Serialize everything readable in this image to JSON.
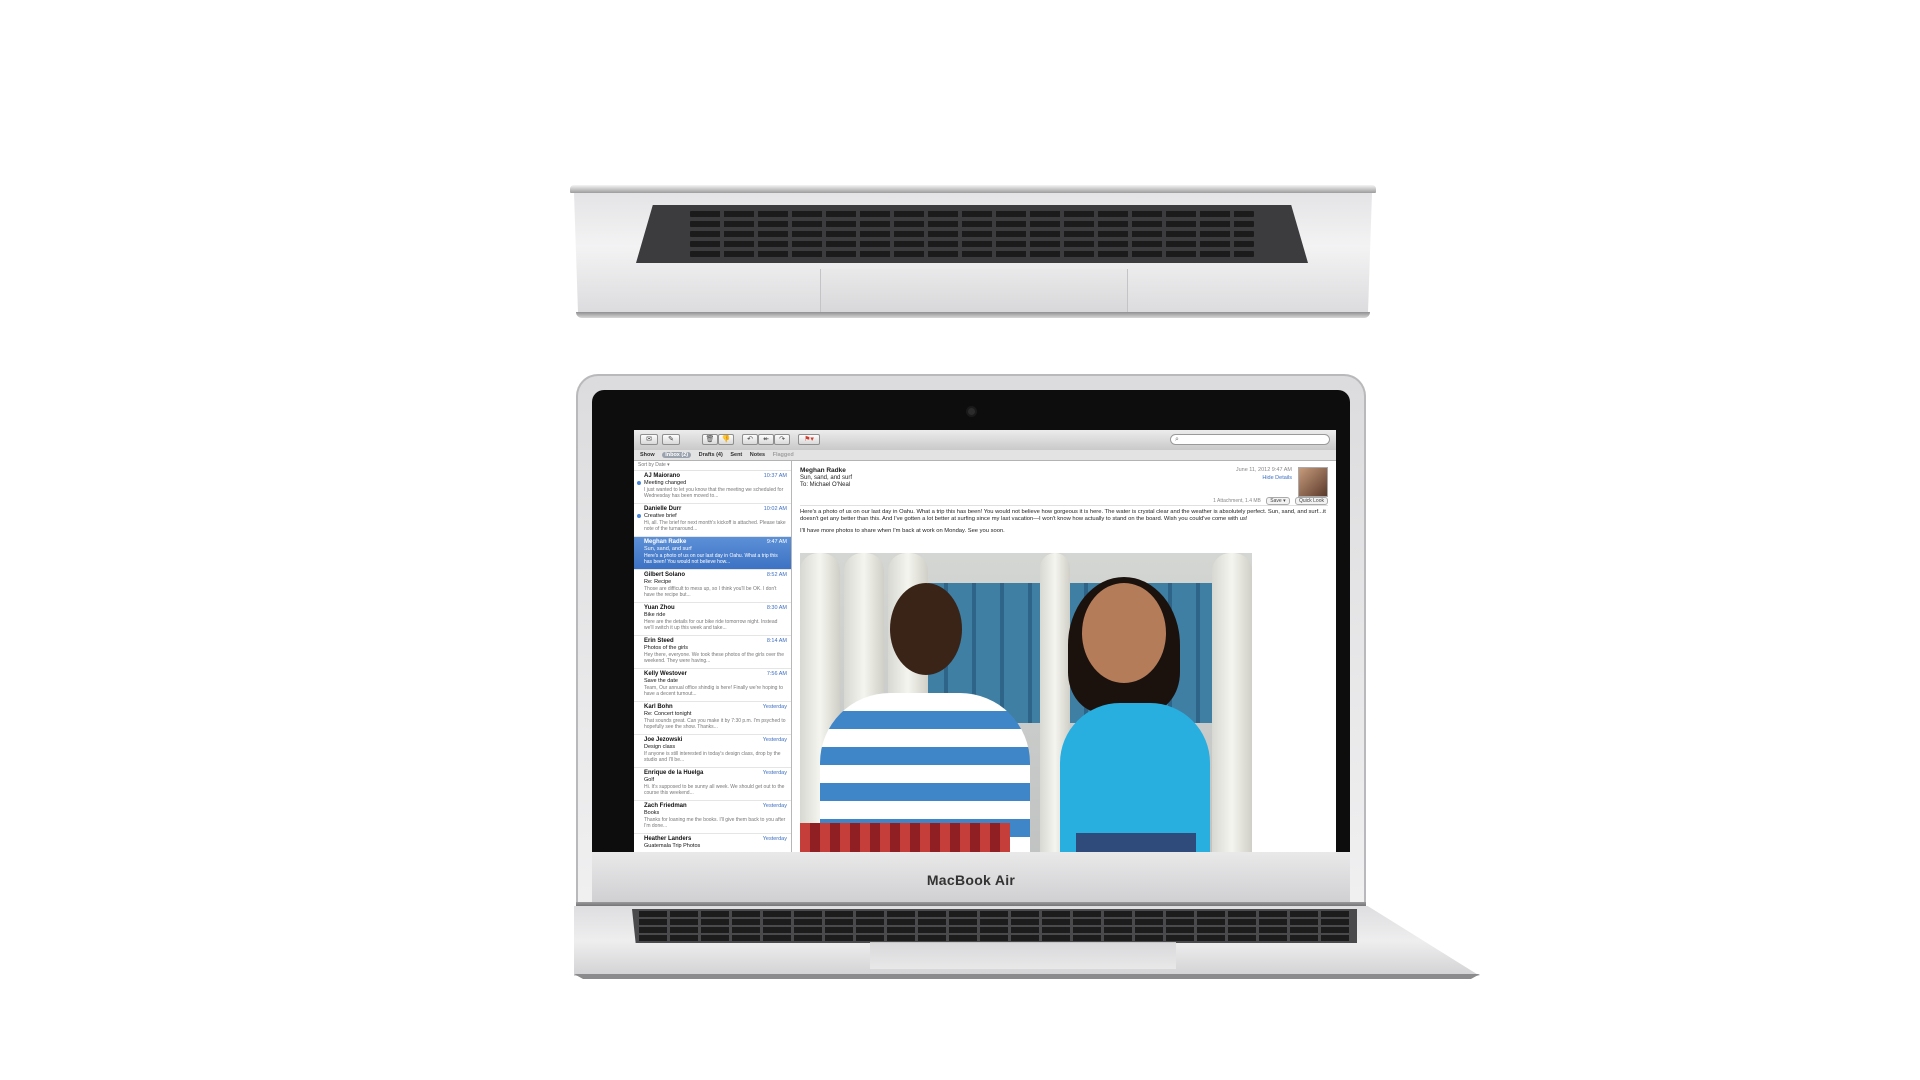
{
  "mail": {
    "search_placeholder": "",
    "favorites": {
      "show": "Show",
      "inbox": "Inbox (2)",
      "drafts": "Drafts (4)",
      "sent": "Sent",
      "notes": "Notes",
      "flagged": "Flagged"
    },
    "sort_label": "Sort by Date ▾",
    "messages": [
      {
        "sender": "AJ Maiorano",
        "time": "10:37 AM",
        "subject": "Meeting changed",
        "preview": "I just wanted to let you know that the meeting we scheduled for Wednesday has been moved to..."
      },
      {
        "sender": "Danielle Durr",
        "time": "10:02 AM",
        "subject": "Creative brief",
        "preview": "Hi, all. The brief for next month's kickoff is attached. Please take note of the turnaround..."
      },
      {
        "sender": "Meghan Radke",
        "time": "9:47 AM",
        "subject": "Sun, sand, and surf",
        "preview": "Here's a photo of us on our last day in Oahu. What a trip this has been! You would not believe how..."
      },
      {
        "sender": "Gilbert Solano",
        "time": "8:52 AM",
        "subject": "Re: Recipe",
        "preview": "Those are difficult to mess up, so I think you'll be OK. I don't have the recipe but..."
      },
      {
        "sender": "Yuan Zhou",
        "time": "8:30 AM",
        "subject": "Bike ride",
        "preview": "Here are the details for our bike ride tomorrow night. Instead we'll switch it up this week and take..."
      },
      {
        "sender": "Erin Steed",
        "time": "8:14 AM",
        "subject": "Photos of the girls",
        "preview": "Hey there, everyone. We took these photos of the girls over the weekend. They were having..."
      },
      {
        "sender": "Kelly Westover",
        "time": "7:56 AM",
        "subject": "Save the date",
        "preview": "Team, Our annual office shindig is here! Finally we're hoping to have a decent turnout..."
      },
      {
        "sender": "Karl Bohn",
        "time": "Yesterday",
        "subject": "Re: Concert tonight",
        "preview": "That sounds great. Can you make it by 7:30 p.m. I'm psyched to hopefully see the show. Thanks..."
      },
      {
        "sender": "Joe Jezowski",
        "time": "Yesterday",
        "subject": "Design class",
        "preview": "If anyone is still interested in today's design class, drop by the studio and I'll be..."
      },
      {
        "sender": "Enrique de la Huelga",
        "time": "Yesterday",
        "subject": "Golf",
        "preview": "Hi. It's supposed to be sunny all week. We should get out to the course this weekend..."
      },
      {
        "sender": "Zach Friedman",
        "time": "Yesterday",
        "subject": "Books",
        "preview": "Thanks for loaning me the books. I'll give them back to you after I'm done..."
      },
      {
        "sender": "Heather Landers",
        "time": "Yesterday",
        "subject": "Guatemala Trip Photos",
        "preview": ""
      }
    ],
    "reader": {
      "from": "Meghan Radke",
      "subject": "Sun, sand, and surf",
      "to": "To:  Michael O'Neal",
      "date": "June 11, 2012 9:47 AM",
      "hide_details": "Hide Details",
      "attachment": "1 Attachment, 1.4 MB",
      "save": "Save ▾",
      "quick_look": "Quick Look",
      "body_1": "Here's a photo of us on our last day in Oahu. What a trip this has been! You would not believe how gorgeous it is here. The water is crystal clear and the weather is absolutely perfect. Sun, sand, and surf...it doesn't get any better than this. And I've gotten a lot better at surfing since my last vacation—I won't know how actually to stand on the board. Wish you could've come with us!",
      "body_2": "I'll have more photos to share when I'm back at work on Monday. See you soon."
    }
  },
  "device": {
    "brand_label": "MacBook Air"
  }
}
